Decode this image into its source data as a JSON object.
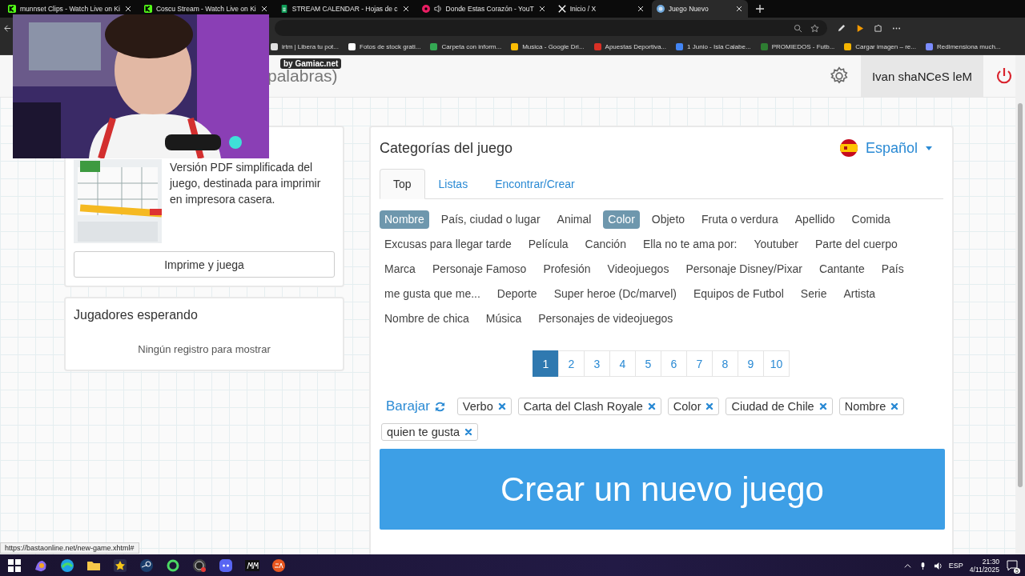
{
  "browser": {
    "tabs": [
      {
        "title": "munnset Clips - Watch Live on Ki",
        "kind": "kick",
        "audio": false,
        "selected": false
      },
      {
        "title": "Coscu Stream - Watch Live on Ki",
        "kind": "kick",
        "audio": false,
        "selected": false
      },
      {
        "title": "STREAM CALENDAR - Hojas de c",
        "kind": "sheets",
        "audio": false,
        "selected": false
      },
      {
        "title": "Donde Estas Corazón - YouT",
        "kind": "youtube",
        "audio": true,
        "selected": false
      },
      {
        "title": "Inicio / X",
        "kind": "x",
        "audio": false,
        "selected": false
      },
      {
        "title": "Juego Nuevo",
        "kind": "globe",
        "audio": false,
        "selected": true
      }
    ],
    "bookmarks": [
      {
        "title": "irtm | Libera tu pot...",
        "color": "#e0e0e0"
      },
      {
        "title": "Fotos de stock grati...",
        "color": "#ffffff"
      },
      {
        "title": "Carpeta con inform...",
        "color": "#34a853"
      },
      {
        "title": "Musica - Google Dri...",
        "color": "#fbbc04"
      },
      {
        "title": "Apuestas Deportiva...",
        "color": "#d93025"
      },
      {
        "title": "1 Junio - Isla Calabe...",
        "color": "#4285f4"
      },
      {
        "title": "PROMIEDOS - Futb...",
        "color": "#2e7d32"
      },
      {
        "title": "Cargar imagen – re...",
        "color": "#f4b400"
      },
      {
        "title": "Redimensiona much...",
        "color": "#7b8cff"
      }
    ]
  },
  "page": {
    "header": {
      "title": "palabras)",
      "badge": "by Gamiac.net",
      "user": "Ivan shaNCeS leM"
    },
    "print_card": {
      "description": "Versión PDF simplificada del juego, destinada para imprimir en impresora casera.",
      "button": "Imprime y juega"
    },
    "players_card": {
      "title": "Jugadores esperando",
      "empty": "Ningún registro para mostrar"
    },
    "categories": {
      "title": "Categorías del juego",
      "language": "Español",
      "tabs": [
        {
          "label": "Top",
          "selected": true
        },
        {
          "label": "Listas",
          "selected": false
        },
        {
          "label": "Encontrar/Crear",
          "selected": false
        }
      ],
      "chips": [
        {
          "label": "Nombre",
          "selected": true
        },
        {
          "label": "País, ciudad o lugar",
          "selected": false
        },
        {
          "label": "Animal",
          "selected": false
        },
        {
          "label": "Color",
          "selected": true
        },
        {
          "label": "Objeto",
          "selected": false
        },
        {
          "label": "Fruta o verdura",
          "selected": false
        },
        {
          "label": "Apellido",
          "selected": false
        },
        {
          "label": "Comida",
          "selected": false
        },
        {
          "label": "Excusas para llegar tarde",
          "selected": false
        },
        {
          "label": "Película",
          "selected": false
        },
        {
          "label": "Canción",
          "selected": false
        },
        {
          "label": "Ella no te ama por:",
          "selected": false
        },
        {
          "label": "Youtuber",
          "selected": false
        },
        {
          "label": "Parte del cuerpo",
          "selected": false
        },
        {
          "label": "Marca",
          "selected": false
        },
        {
          "label": "Personaje Famoso",
          "selected": false
        },
        {
          "label": "Profesión",
          "selected": false
        },
        {
          "label": "Videojuegos",
          "selected": false
        },
        {
          "label": "Personaje Disney/Pixar",
          "selected": false
        },
        {
          "label": "Cantante",
          "selected": false
        },
        {
          "label": "País",
          "selected": false
        },
        {
          "label": "me gusta que me...",
          "selected": false
        },
        {
          "label": "Deporte",
          "selected": false
        },
        {
          "label": "Super heroe (Dc/marvel)",
          "selected": false
        },
        {
          "label": "Equipos de Futbol",
          "selected": false
        },
        {
          "label": "Serie",
          "selected": false
        },
        {
          "label": "Artista",
          "selected": false
        },
        {
          "label": "Nombre de chica",
          "selected": false
        },
        {
          "label": "Música",
          "selected": false
        },
        {
          "label": "Personajes de videojuegos",
          "selected": false
        }
      ],
      "pages": [
        {
          "label": "1",
          "selected": true
        },
        {
          "label": "2",
          "selected": false
        },
        {
          "label": "3",
          "selected": false
        },
        {
          "label": "4",
          "selected": false
        },
        {
          "label": "5",
          "selected": false
        },
        {
          "label": "6",
          "selected": false
        },
        {
          "label": "7",
          "selected": false
        },
        {
          "label": "8",
          "selected": false
        },
        {
          "label": "9",
          "selected": false
        },
        {
          "label": "10",
          "selected": false
        }
      ],
      "shuffle": "Barajar",
      "tags": [
        "Verbo",
        "Carta del Clash Royale",
        "Color",
        "Ciudad de Chile",
        "Nombre",
        "quien te gusta"
      ],
      "create_button": "Crear un nuevo juego"
    }
  },
  "status_url": "https://bastaonline.net/new-game.xhtml#",
  "taskbar": {
    "apps": [
      {
        "kind": "start"
      },
      {
        "kind": "copilot"
      },
      {
        "kind": "edge"
      },
      {
        "kind": "folder"
      },
      {
        "kind": "star"
      },
      {
        "kind": "steam"
      },
      {
        "kind": "ring"
      },
      {
        "kind": "obs"
      },
      {
        "kind": "discord"
      },
      {
        "kind": "mm"
      },
      {
        "kind": "ea"
      }
    ],
    "language": "ESP",
    "time": "21:30",
    "date": "4/11/2025",
    "notifications": "5"
  }
}
